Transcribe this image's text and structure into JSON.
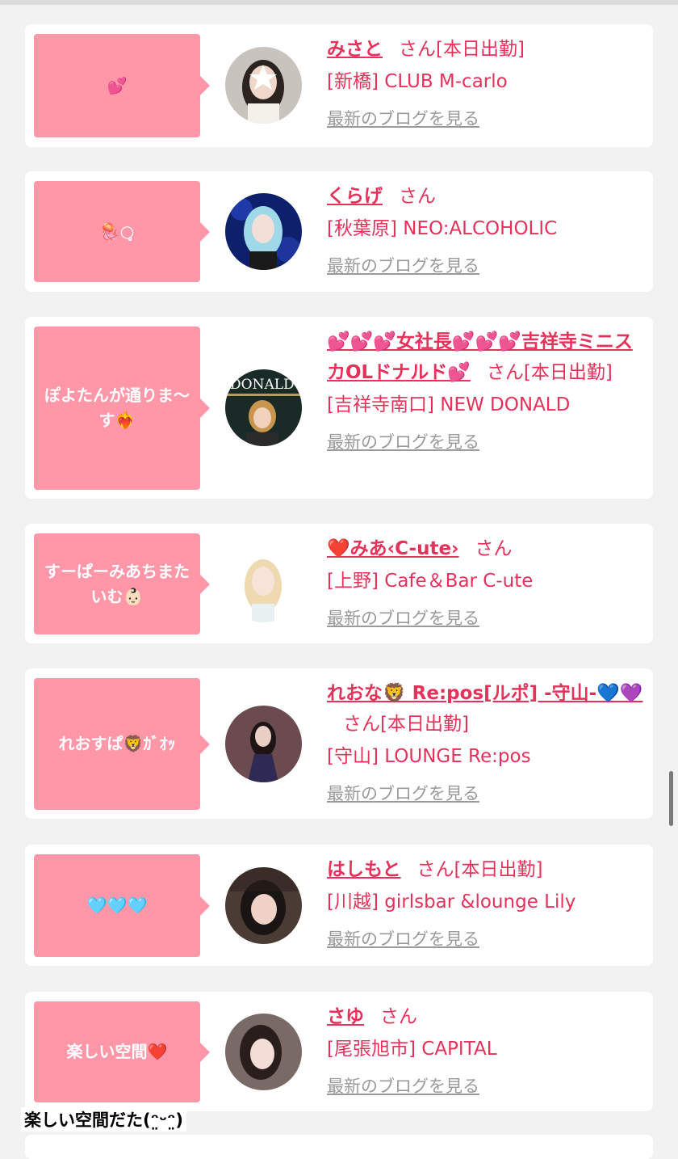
{
  "blog_link_label": "最新のブログを見る",
  "entries": [
    {
      "bubble": "💕",
      "name": "みさと",
      "san": "さん",
      "status": "[本日出勤]",
      "shop": "[新橋] CLUB M-carlo"
    },
    {
      "bubble": "🪼○̥",
      "name": "くらげ",
      "san": "さん",
      "status": "",
      "shop": "[秋葉原] NEO:ALCOHOLIC"
    },
    {
      "bubble": "ぽよたんが通りま〜す❤️‍🔥",
      "name": "💕💕💕女社長💕💕💕吉祥寺ミニスカOLドナルド💕",
      "san": "さん",
      "status": "[本日出勤]",
      "shop": "[吉祥寺南口] NEW DONALD",
      "avatar_text": "DONALD"
    },
    {
      "bubble": "すーぱーみあちまたいむ👶🏻",
      "name": "❤️みあ‹C-ute›",
      "san": "さん",
      "status": "",
      "shop": "[上野] Cafe＆Bar C-ute"
    },
    {
      "bubble": "れおすぱ🦁ｶﾞｵｯ",
      "name": "れおな🦁 Re:pos[ルポ] -守山-💙💜",
      "san": "さん",
      "status": "[本日出勤]",
      "shop": "[守山] LOUNGE Re:pos"
    },
    {
      "bubble": "🩵🩵🩵",
      "name": "はしもと",
      "san": "さん",
      "status": "[本日出勤]",
      "shop": "[川越] girlsbar &lounge Lily"
    },
    {
      "bubble": "楽しい空間❤️",
      "name": "さゆ",
      "san": "さん",
      "status": "",
      "shop": "[尾張旭市] CAPITAL"
    }
  ],
  "caption": "楽しい空間だた(ᵔ̤ᵕᵔ̤)",
  "colors": {
    "bubble": "#ff97a9",
    "accent": "#e6325a",
    "link_gray": "#9a9a9a"
  }
}
